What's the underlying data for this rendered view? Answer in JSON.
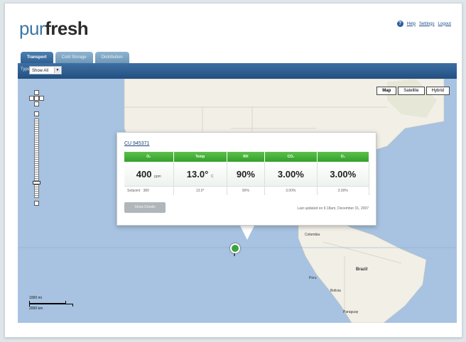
{
  "app": {
    "logo_light": "pur",
    "logo_bold": "fresh"
  },
  "top_links": {
    "help": "Help",
    "settings": "Settings",
    "logout": "Logout"
  },
  "tabs": [
    {
      "label": "Transport",
      "active": true
    },
    {
      "label": "Cold Storage",
      "active": false
    },
    {
      "label": "Distribution",
      "active": false
    }
  ],
  "filter": {
    "label": "Type",
    "value": "Show All"
  },
  "map_types": [
    {
      "label": "Map",
      "selected": true
    },
    {
      "label": "Satellite",
      "selected": false
    },
    {
      "label": "Hybrid",
      "selected": false
    }
  ],
  "popup": {
    "container_id": "CU 945371",
    "columns": [
      {
        "header": "O₂",
        "value": "400",
        "unit": "ppm",
        "setpoint": "380"
      },
      {
        "header": "Temp",
        "value": "13.0°",
        "unit": "C",
        "setpoint": "13.0°"
      },
      {
        "header": "RH",
        "value": "90%",
        "unit": "",
        "setpoint": "90%"
      },
      {
        "header": "CO₂",
        "value": "3.00%",
        "unit": "",
        "setpoint": "3.00%"
      },
      {
        "header": "O₂",
        "value": "3.00%",
        "unit": "",
        "setpoint": "3.00%"
      }
    ],
    "setpoint_label": "Setpoint",
    "details_button": "Show Details",
    "last_updated": "Last updated on 6:18am, December 31, 2007"
  },
  "map_labels": {
    "colombia": "Colombia",
    "brazil": "Brazil",
    "peru": "Peru",
    "bolivia": "Bolivia",
    "paraguay": "Paraguay"
  },
  "scale": {
    "top": "1000 mi",
    "bottom": "2000 km"
  },
  "colors": {
    "accent": "#3c77a5",
    "green_header": "#3aa532",
    "toolbar": "#2d5f93",
    "ocean": "#a7c3e1"
  }
}
